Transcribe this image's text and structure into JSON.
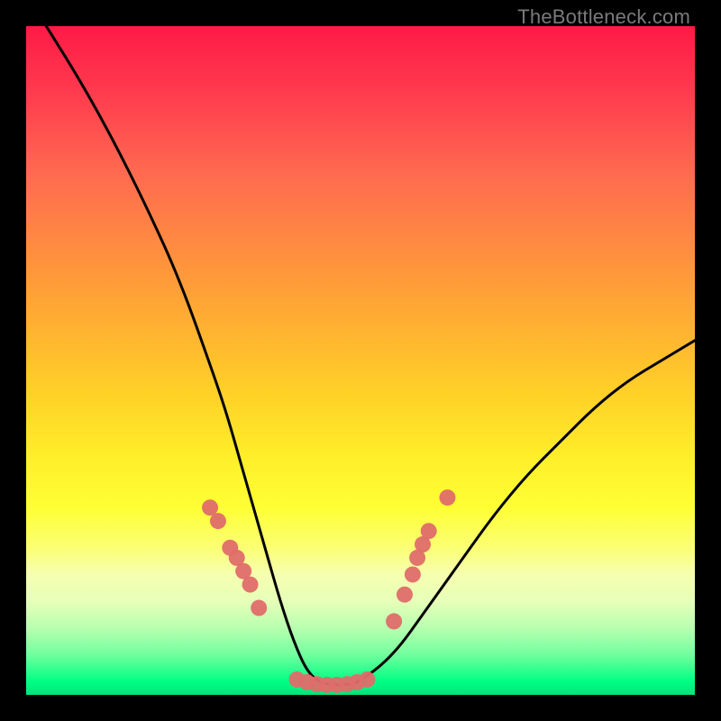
{
  "watermark": "TheBottleneck.com",
  "chart_data": {
    "type": "line",
    "title": "",
    "xlabel": "",
    "ylabel": "",
    "xlim": [
      0,
      100
    ],
    "ylim": [
      0,
      100
    ],
    "grid": false,
    "legend": false,
    "background_gradient": [
      "#ff1a46",
      "#ffd127",
      "#ffff34",
      "#00e37a"
    ],
    "series": [
      {
        "name": "bottleneck-curve",
        "color": "#000000",
        "x": [
          3,
          8,
          13,
          18,
          23,
          28,
          30,
          32,
          34,
          36,
          38,
          40,
          42,
          44,
          46,
          48,
          50,
          55,
          60,
          65,
          70,
          75,
          80,
          85,
          90,
          95,
          100
        ],
        "y": [
          100,
          92,
          83,
          73,
          62,
          48,
          42,
          35,
          28,
          21,
          14,
          8,
          3.5,
          1.8,
          1.5,
          1.5,
          2,
          6,
          13,
          20,
          27,
          33,
          38,
          43,
          47,
          50,
          53
        ]
      }
    ],
    "markers": [
      {
        "name": "left-cluster",
        "color": "#df6d6a",
        "points": [
          {
            "x": 27.5,
            "y": 28.0
          },
          {
            "x": 28.7,
            "y": 26.0
          },
          {
            "x": 30.5,
            "y": 22.0
          },
          {
            "x": 31.5,
            "y": 20.5
          },
          {
            "x": 32.5,
            "y": 18.5
          },
          {
            "x": 33.5,
            "y": 16.5
          },
          {
            "x": 34.8,
            "y": 13.0
          }
        ]
      },
      {
        "name": "bottom-cluster",
        "color": "#df6d6a",
        "points": [
          {
            "x": 40.5,
            "y": 2.3
          },
          {
            "x": 42.0,
            "y": 1.9
          },
          {
            "x": 43.5,
            "y": 1.6
          },
          {
            "x": 45.0,
            "y": 1.5
          },
          {
            "x": 46.5,
            "y": 1.5
          },
          {
            "x": 48.0,
            "y": 1.6
          },
          {
            "x": 49.5,
            "y": 1.9
          },
          {
            "x": 51.0,
            "y": 2.3
          }
        ]
      },
      {
        "name": "right-cluster",
        "color": "#df6d6a",
        "points": [
          {
            "x": 55.0,
            "y": 11.0
          },
          {
            "x": 56.6,
            "y": 15.0
          },
          {
            "x": 57.8,
            "y": 18.0
          },
          {
            "x": 58.5,
            "y": 20.5
          },
          {
            "x": 59.3,
            "y": 22.5
          },
          {
            "x": 60.2,
            "y": 24.5
          },
          {
            "x": 63.0,
            "y": 29.5
          }
        ]
      }
    ]
  }
}
